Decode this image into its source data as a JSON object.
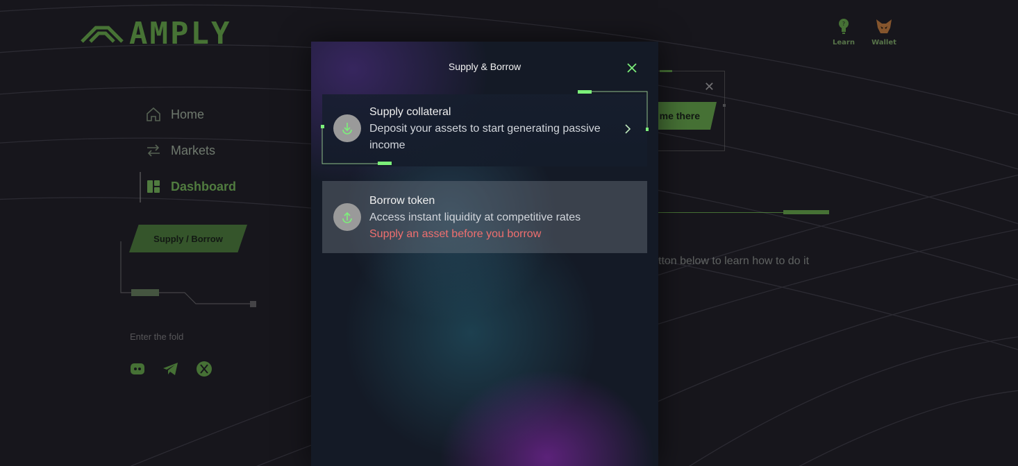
{
  "app": {
    "brand": "AMPLY",
    "topbar": {
      "learn_label": "Learn",
      "wallet_label": "Wallet"
    },
    "nav": {
      "items": [
        {
          "label": "Home",
          "icon": "home-icon"
        },
        {
          "label": "Markets",
          "icon": "arrows-icon"
        },
        {
          "label": "Dashboard",
          "icon": "dashboard-icon",
          "active": true
        }
      ]
    },
    "supply_borrow_button": "Supply / Borrow",
    "footer": {
      "fold_label": "Enter the fold",
      "socials": [
        "discord-icon",
        "telegram-icon",
        "x-icon"
      ]
    },
    "background_card": {
      "button_label": "me there",
      "hint_text": "tton below to learn how to do it"
    }
  },
  "modal": {
    "title": "Supply & Borrow",
    "options": [
      {
        "title": "Supply collateral",
        "description": "Deposit your assets to start generating passive income",
        "icon": "download-icon"
      },
      {
        "title": "Borrow token",
        "description": "Access instant liquidity at competitive rates",
        "warning": "Supply an asset before you borrow",
        "icon": "upload-icon"
      }
    ]
  },
  "colors": {
    "accent_green": "#6dbd4b",
    "highlight_green": "#7cf07a",
    "warning_red": "#f06f6f",
    "background": "#17161c"
  }
}
